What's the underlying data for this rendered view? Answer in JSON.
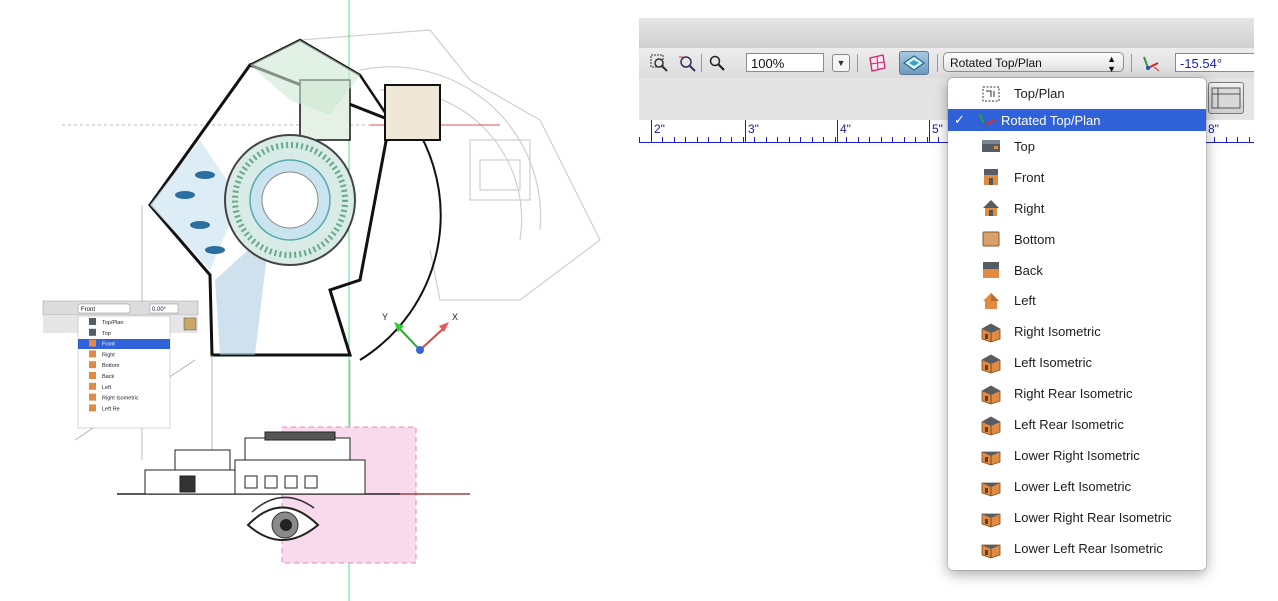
{
  "toolbar": {
    "zoom_value": "100%",
    "view_select_value": "Rotated Top/Plan",
    "angle_value": "-15.54°"
  },
  "ruler": {
    "labels": [
      "2\"",
      "3\"",
      "4\"",
      "5\"",
      "8\""
    ]
  },
  "view_menu": {
    "checkmark": "✓",
    "items": [
      {
        "label": "Top/Plan",
        "icon": "top-plan-icon"
      },
      {
        "label": "Rotated Top/Plan",
        "icon": "rotated-plan-icon",
        "selected": true
      },
      {
        "label": "Top",
        "icon": "top-view-icon"
      },
      {
        "label": "Front",
        "icon": "front-view-icon"
      },
      {
        "label": "Right",
        "icon": "right-view-icon"
      },
      {
        "label": "Bottom",
        "icon": "bottom-view-icon"
      },
      {
        "label": "Back",
        "icon": "back-view-icon"
      },
      {
        "label": "Left",
        "icon": "left-view-icon"
      },
      {
        "label": "Right Isometric",
        "icon": "right-isometric-icon"
      },
      {
        "label": "Left Isometric",
        "icon": "left-isometric-icon"
      },
      {
        "label": "Right Rear Isometric",
        "icon": "right-rear-isometric-icon"
      },
      {
        "label": "Left Rear Isometric",
        "icon": "left-rear-isometric-icon"
      },
      {
        "label": "Lower Right Isometric",
        "icon": "lower-right-isometric-icon"
      },
      {
        "label": "Lower Left Isometric",
        "icon": "lower-left-isometric-icon"
      },
      {
        "label": "Lower Right Rear Isometric",
        "icon": "lower-right-rear-isometric-icon"
      },
      {
        "label": "Lower Left Rear Isometric",
        "icon": "lower-left-rear-isometric-icon"
      }
    ]
  },
  "mini_menu": {
    "select_value": "Front",
    "angle_value": "0.00°",
    "items": [
      "Top/Plan",
      "Top",
      "Front",
      "Right",
      "Bottom",
      "Back",
      "Left",
      "Right Isometric",
      "Left Re"
    ],
    "selected_index": 2
  },
  "axes": {
    "x_label": "X",
    "y_label": "Y"
  },
  "colors": {
    "menu_highlight": "#2f61d8",
    "ruler_blue": "#1d1dd0",
    "pink_plane": "#f9d9ec",
    "green_guide": "#3fd98a"
  }
}
